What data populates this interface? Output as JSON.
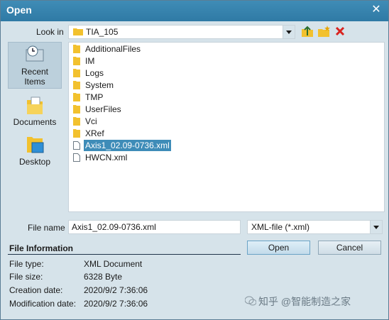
{
  "window": {
    "title": "Open"
  },
  "look_in": {
    "label": "Look in",
    "value": "TIA_105"
  },
  "places": [
    {
      "label_line1": "Recent",
      "label_line2": "Items",
      "icon": "recent-items-icon",
      "active": true
    },
    {
      "label_line1": "Documents",
      "label_line2": "",
      "icon": "documents-icon",
      "active": false
    },
    {
      "label_line1": "Desktop",
      "label_line2": "",
      "icon": "desktop-icon",
      "active": false
    }
  ],
  "files": [
    {
      "name": "AdditionalFiles",
      "type": "folder"
    },
    {
      "name": "IM",
      "type": "folder"
    },
    {
      "name": "Logs",
      "type": "folder"
    },
    {
      "name": "System",
      "type": "folder"
    },
    {
      "name": "TMP",
      "type": "folder"
    },
    {
      "name": "UserFiles",
      "type": "folder"
    },
    {
      "name": "Vci",
      "type": "folder"
    },
    {
      "name": "XRef",
      "type": "folder"
    },
    {
      "name": "Axis1_02.09-0736.xml",
      "type": "file",
      "selected": true
    },
    {
      "name": "HWCN.xml",
      "type": "file"
    }
  ],
  "file_name": {
    "label": "File name",
    "value": "Axis1_02.09-0736.xml"
  },
  "file_type": {
    "value": "XML-file (*.xml)"
  },
  "buttons": {
    "open": "Open",
    "cancel": "Cancel"
  },
  "file_info": {
    "title": "File Information",
    "rows": [
      {
        "key": "File type:",
        "value": "XML Document"
      },
      {
        "key": "File size:",
        "value": "6328 Byte"
      },
      {
        "key": "Creation date:",
        "value": "2020/9/2 7:36:06"
      },
      {
        "key": "Modification date:",
        "value": "2020/9/2 7:36:06"
      }
    ]
  },
  "watermark": {
    "text": "知乎 @智能制造之家"
  },
  "colors": {
    "titlebar": "#3a86b0",
    "selection": "#3e8cb8",
    "folder": "#f2c12e",
    "background": "#d6e3ea"
  }
}
